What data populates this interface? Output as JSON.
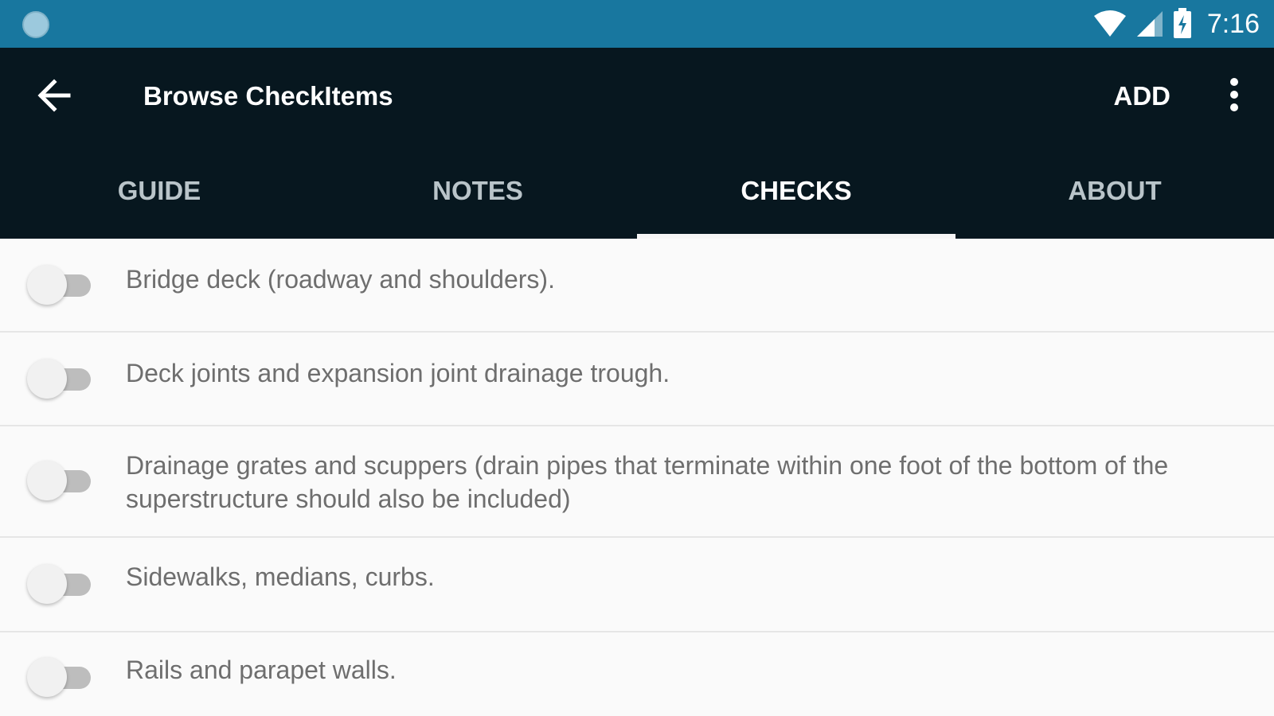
{
  "status_bar": {
    "time": "7:16",
    "icons": [
      "circle-notification-icon",
      "wifi-icon",
      "signal-icon",
      "battery-charging-icon"
    ],
    "bg_color": "#18779f"
  },
  "toolbar": {
    "title": "Browse CheckItems",
    "add_label": "ADD",
    "bg_color": "#07171f"
  },
  "tabs": [
    {
      "label": "GUIDE",
      "active": false
    },
    {
      "label": "NOTES",
      "active": false
    },
    {
      "label": "CHECKS",
      "active": true
    },
    {
      "label": "ABOUT",
      "active": false
    }
  ],
  "check_items": [
    {
      "text": "Bridge deck (roadway and shoulders).",
      "checked": false
    },
    {
      "text": "Deck joints and expansion joint drainage trough.",
      "checked": false
    },
    {
      "text": "Drainage grates and scuppers (drain pipes that terminate within one foot of the bottom of the superstructure should also be included)",
      "checked": false
    },
    {
      "text": "Sidewalks, medians, curbs.",
      "checked": false
    },
    {
      "text": "Rails and parapet walls.",
      "checked": false
    }
  ]
}
